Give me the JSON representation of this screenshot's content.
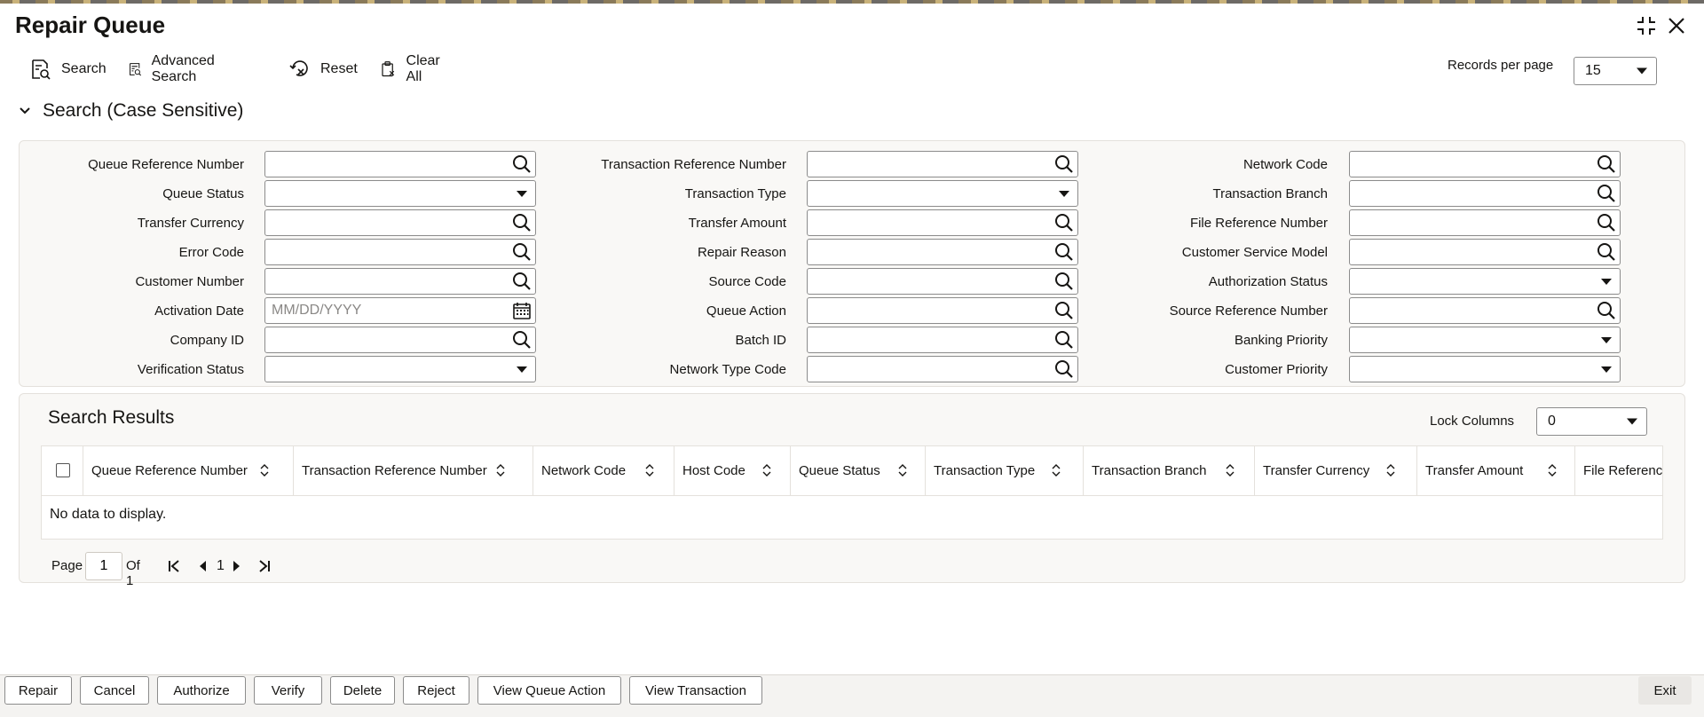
{
  "page": {
    "title": "Repair Queue"
  },
  "toolbar": {
    "search": "Search",
    "advanced_search": "Advanced Search",
    "reset": "Reset",
    "clear_all": "Clear All",
    "records_per_page_label": "Records per page",
    "records_per_page_value": "15"
  },
  "search_section": {
    "title": "Search (Case Sensitive)",
    "fields": [
      {
        "label": "Queue Reference Number",
        "type": "lookup",
        "value": ""
      },
      {
        "label": "Transaction Reference Number",
        "type": "lookup",
        "value": ""
      },
      {
        "label": "Network Code",
        "type": "lookup",
        "value": ""
      },
      {
        "label": "Queue Status",
        "type": "select",
        "value": ""
      },
      {
        "label": "Transaction Type",
        "type": "select",
        "value": ""
      },
      {
        "label": "Transaction Branch",
        "type": "lookup",
        "value": ""
      },
      {
        "label": "Transfer Currency",
        "type": "lookup",
        "value": ""
      },
      {
        "label": "Transfer Amount",
        "type": "lookup",
        "value": ""
      },
      {
        "label": "File Reference Number",
        "type": "lookup",
        "value": ""
      },
      {
        "label": "Error Code",
        "type": "lookup",
        "value": ""
      },
      {
        "label": "Repair Reason",
        "type": "lookup",
        "value": ""
      },
      {
        "label": "Customer Service Model",
        "type": "lookup",
        "value": ""
      },
      {
        "label": "Customer Number",
        "type": "lookup",
        "value": ""
      },
      {
        "label": "Source Code",
        "type": "lookup",
        "value": ""
      },
      {
        "label": "Authorization Status",
        "type": "select",
        "value": ""
      },
      {
        "label": "Activation Date",
        "type": "date",
        "value": "",
        "placeholder": "MM/DD/YYYY"
      },
      {
        "label": "Queue Action",
        "type": "lookup",
        "value": ""
      },
      {
        "label": "Source Reference Number",
        "type": "lookup",
        "value": ""
      },
      {
        "label": "Company ID",
        "type": "lookup",
        "value": ""
      },
      {
        "label": "Batch ID",
        "type": "lookup",
        "value": ""
      },
      {
        "label": "Banking Priority",
        "type": "select",
        "value": ""
      },
      {
        "label": "Verification Status",
        "type": "select",
        "value": ""
      },
      {
        "label": "Network Type Code",
        "type": "lookup",
        "value": ""
      },
      {
        "label": "Customer Priority",
        "type": "select",
        "value": ""
      }
    ]
  },
  "results": {
    "title": "Search Results",
    "lock_columns_label": "Lock Columns",
    "lock_columns_value": "0",
    "columns": [
      "Queue Reference Number",
      "Transaction Reference Number",
      "Network Code",
      "Host Code",
      "Queue Status",
      "Transaction Type",
      "Transaction Branch",
      "Transfer Currency",
      "Transfer Amount",
      "File Reference"
    ],
    "empty_message": "No data to display."
  },
  "pagination": {
    "page_label": "Page",
    "current_page": "1",
    "of_label": "Of 1",
    "page_link": "1"
  },
  "footer": {
    "buttons": [
      "Repair",
      "Cancel",
      "Authorize",
      "Verify",
      "Delete",
      "Reject",
      "View Queue Action",
      "View Transaction"
    ],
    "exit": "Exit"
  },
  "icons": {
    "maximize": "maximize-icon",
    "close": "close-icon",
    "search": "search-icon",
    "calendar": "calendar-icon",
    "chevron": "chevron-down-icon",
    "sort": "sort-icon"
  }
}
